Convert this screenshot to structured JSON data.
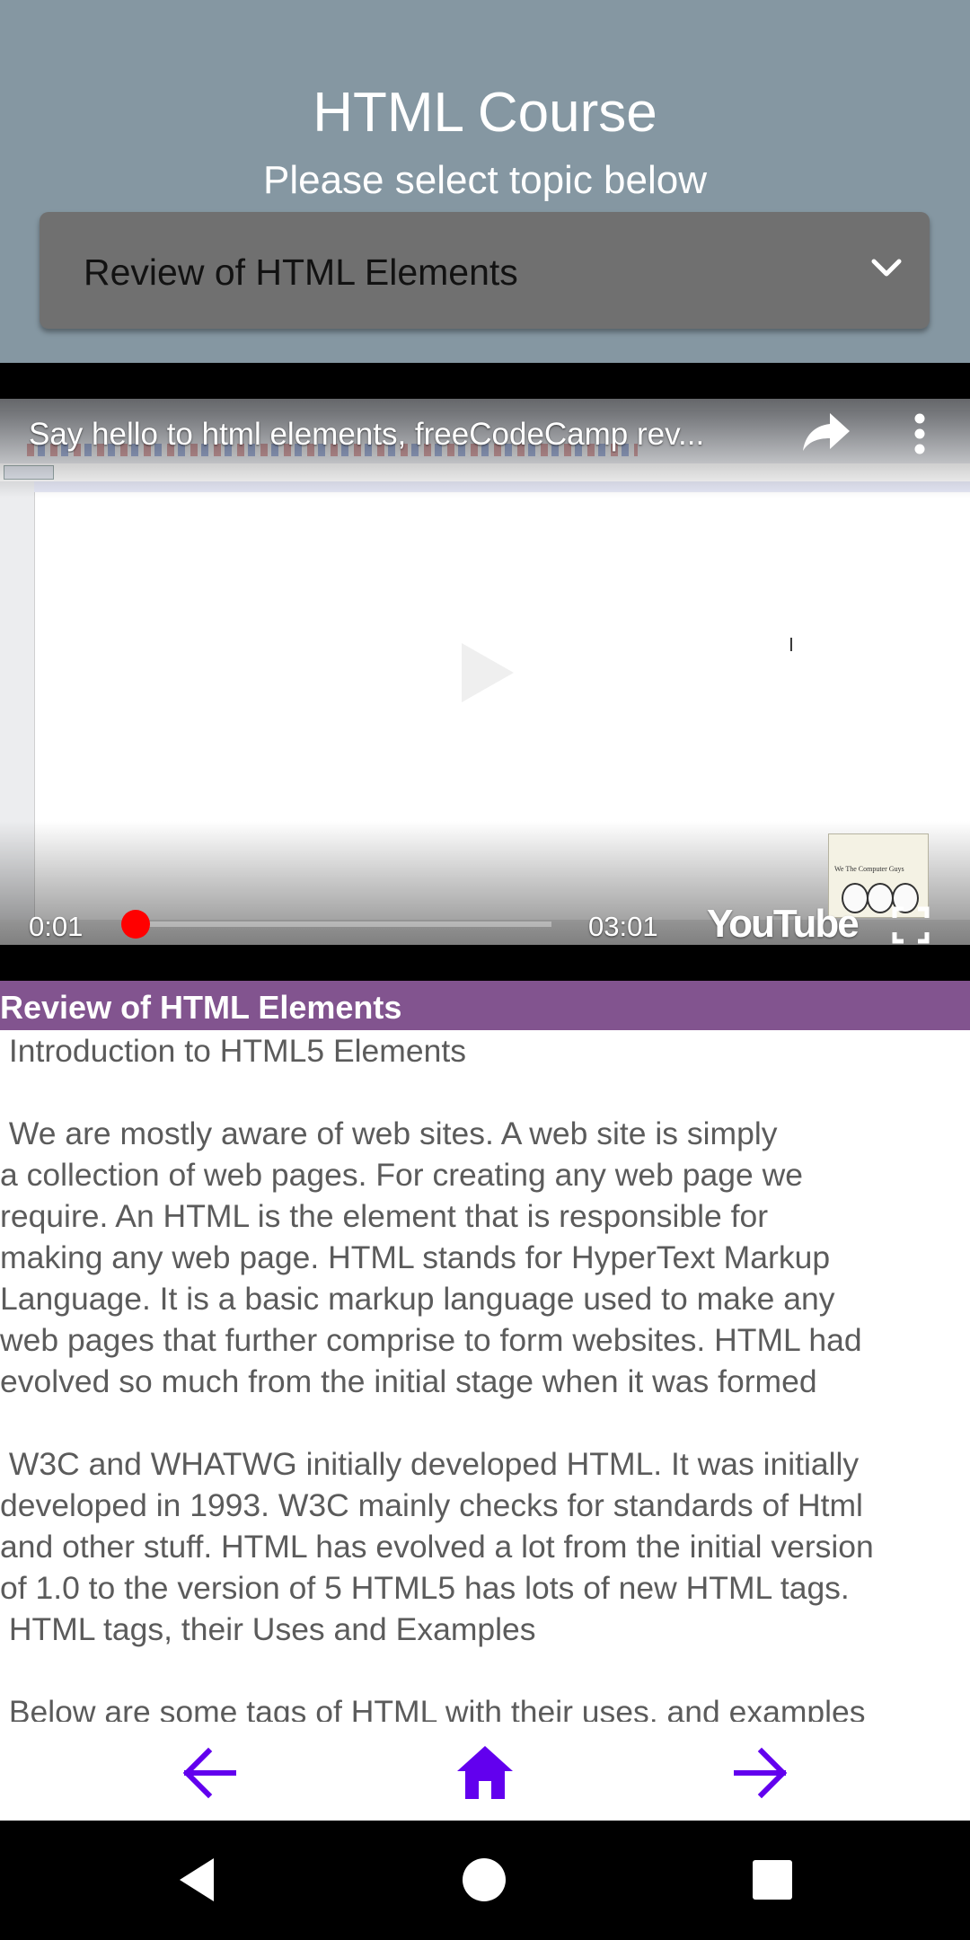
{
  "header": {
    "title": "HTML Course",
    "subtitle": "Please select topic below",
    "topic_select": {
      "selected": "Review of HTML Elements",
      "icon": "chevron-down-icon"
    }
  },
  "video": {
    "title": "Say hello to html elements, freeCodeCamp rev...",
    "current_time": "0:01",
    "total_time": "03:01",
    "progress": 0.0055,
    "brand": "YouTube",
    "icons": [
      "share-icon",
      "more-vert-icon",
      "fullscreen-icon",
      "play-icon"
    ],
    "thumbnail_caption": "We The Computer Guys"
  },
  "section": {
    "title": "Review of HTML Elements"
  },
  "content": {
    "text": " Introduction to HTML5 Elements\n\n We are mostly aware of web sites. A web site is simply\na collection of web pages. For creating any web page we\nrequire. An HTML is the element that is responsible for\nmaking any web page. HTML stands for HyperText Markup\nLanguage. It is a basic markup language used to make any\nweb pages that further comprise to form websites. HTML had\nevolved so much from the initial stage when it was formed\n\n W3C and WHATWG initially developed HTML. It was initially\ndeveloped in 1993. W3C mainly checks for standards of Html\nand other stuff. HTML has evolved a lot from the initial version\nof 1.0 to the version of 5 HTML5 has lots of new HTML tags.\n HTML tags, their Uses and Examples\n\n Below are some tags of HTML with their uses, and examples"
  },
  "bottom_nav": {
    "items": [
      {
        "icon": "arrow-back-icon"
      },
      {
        "icon": "home-icon"
      },
      {
        "icon": "arrow-forward-icon"
      }
    ],
    "accent": "#6200ee"
  },
  "system_nav": {
    "items": [
      "back-triangle-icon",
      "home-circle-icon",
      "recents-square-icon"
    ]
  },
  "colors": {
    "header_bg": "#8597a2",
    "select_bg": "#707070",
    "section_header_bg": "#82548f",
    "body_text": "#5b5b5b",
    "progress": "#ff0000"
  }
}
